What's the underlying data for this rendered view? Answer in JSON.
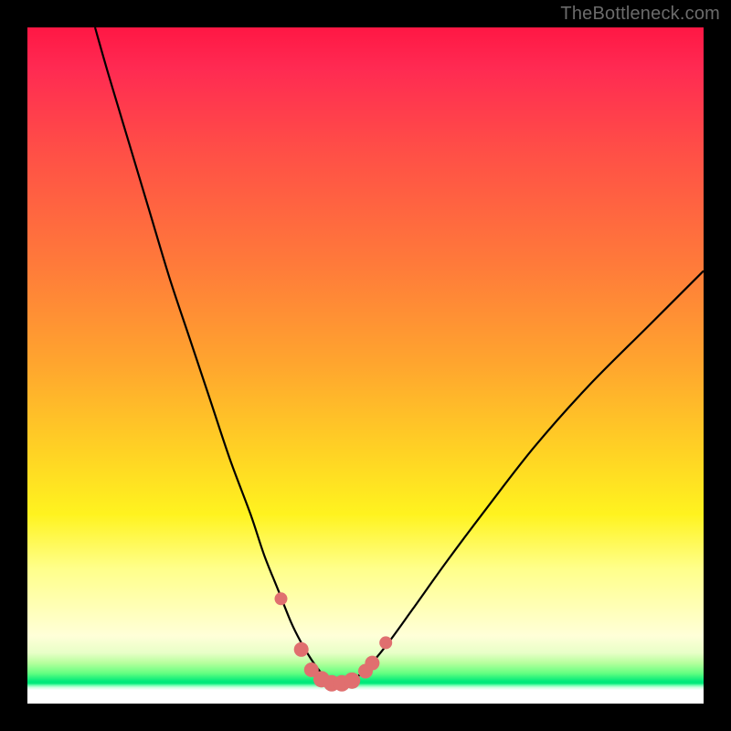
{
  "watermark": "TheBottleneck.com",
  "chart_data": {
    "type": "line",
    "title": "",
    "xlabel": "",
    "ylabel": "",
    "xlim": [
      0,
      100
    ],
    "ylim": [
      0,
      100
    ],
    "series": [
      {
        "name": "bottleneck-curve",
        "x": [
          10,
          12,
          15,
          18,
          21,
          24,
          27,
          30,
          33,
          35,
          37,
          39,
          40.5,
          42,
          43.5,
          45,
          46.5,
          48,
          50,
          53,
          57,
          62,
          68,
          75,
          83,
          92,
          100
        ],
        "y": [
          100,
          93,
          83,
          73,
          63,
          54,
          45,
          36,
          28,
          22,
          17,
          12,
          9,
          6.5,
          4.5,
          3.3,
          3.1,
          3.5,
          5,
          8.5,
          14,
          21,
          29,
          38,
          47,
          56,
          64
        ]
      }
    ],
    "markers": {
      "name": "highlight-dots",
      "x": [
        37.5,
        40.5,
        42.0,
        43.5,
        45.0,
        46.5,
        48.0,
        50.0,
        51.0,
        53.0
      ],
      "y": [
        15.5,
        8.0,
        5.0,
        3.6,
        3.0,
        3.0,
        3.4,
        4.8,
        6.0,
        9.0
      ],
      "r": [
        7,
        8,
        8,
        9,
        9,
        9,
        9,
        8,
        8,
        7
      ]
    }
  }
}
